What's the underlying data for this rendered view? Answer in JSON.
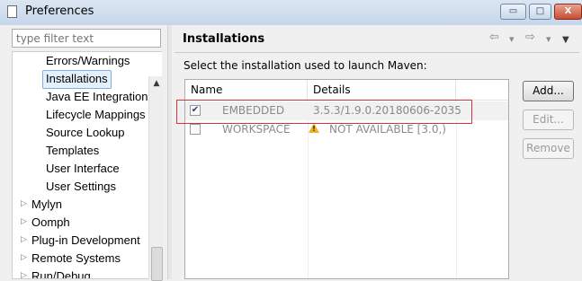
{
  "window": {
    "title": "Preferences",
    "minimize_glyph": "▭",
    "maximize_glyph": "□",
    "close_glyph": "X"
  },
  "sidebar": {
    "filter_placeholder": "type filter text",
    "items": [
      {
        "label": "Errors/Warnings",
        "expandable": false
      },
      {
        "label": "Installations",
        "expandable": false,
        "selected": true
      },
      {
        "label": "Java EE Integration",
        "expandable": false
      },
      {
        "label": "Lifecycle Mappings",
        "expandable": false
      },
      {
        "label": "Source Lookup",
        "expandable": false
      },
      {
        "label": "Templates",
        "expandable": false
      },
      {
        "label": "User Interface",
        "expandable": false
      },
      {
        "label": "User Settings",
        "expandable": false
      },
      {
        "label": "Mylyn",
        "expandable": true
      },
      {
        "label": "Oomph",
        "expandable": true
      },
      {
        "label": "Plug-in Development",
        "expandable": true
      },
      {
        "label": "Remote Systems",
        "expandable": true
      },
      {
        "label": "Run/Debug",
        "expandable": true
      }
    ],
    "expand_glyph": "▷",
    "scroll_up_glyph": "▲"
  },
  "main": {
    "title": "Installations",
    "description": "Select the installation used to launch Maven:",
    "nav": {
      "back_glyph": "⇦",
      "back_menu_glyph": "▾",
      "forward_glyph": "⇨",
      "forward_menu_glyph": "▾",
      "view_menu_glyph": "▼"
    },
    "table": {
      "columns": [
        "Name",
        "Details"
      ],
      "rows": [
        {
          "checked": true,
          "name": "EMBEDDED",
          "details": "3.5.3/1.9.0.20180606-2035",
          "warning": false
        },
        {
          "checked": false,
          "name": "WORKSPACE",
          "details": "NOT AVAILABLE [3.0,)",
          "warning": true
        }
      ],
      "check_glyph": "✔",
      "warning_glyph": "!"
    },
    "buttons": {
      "add": "Add...",
      "edit": "Edit...",
      "remove": "Remove"
    }
  },
  "colors": {
    "highlight_border": "#d9323a",
    "selection_bg": "#e3f1fd",
    "warning": "#e7b42a"
  }
}
